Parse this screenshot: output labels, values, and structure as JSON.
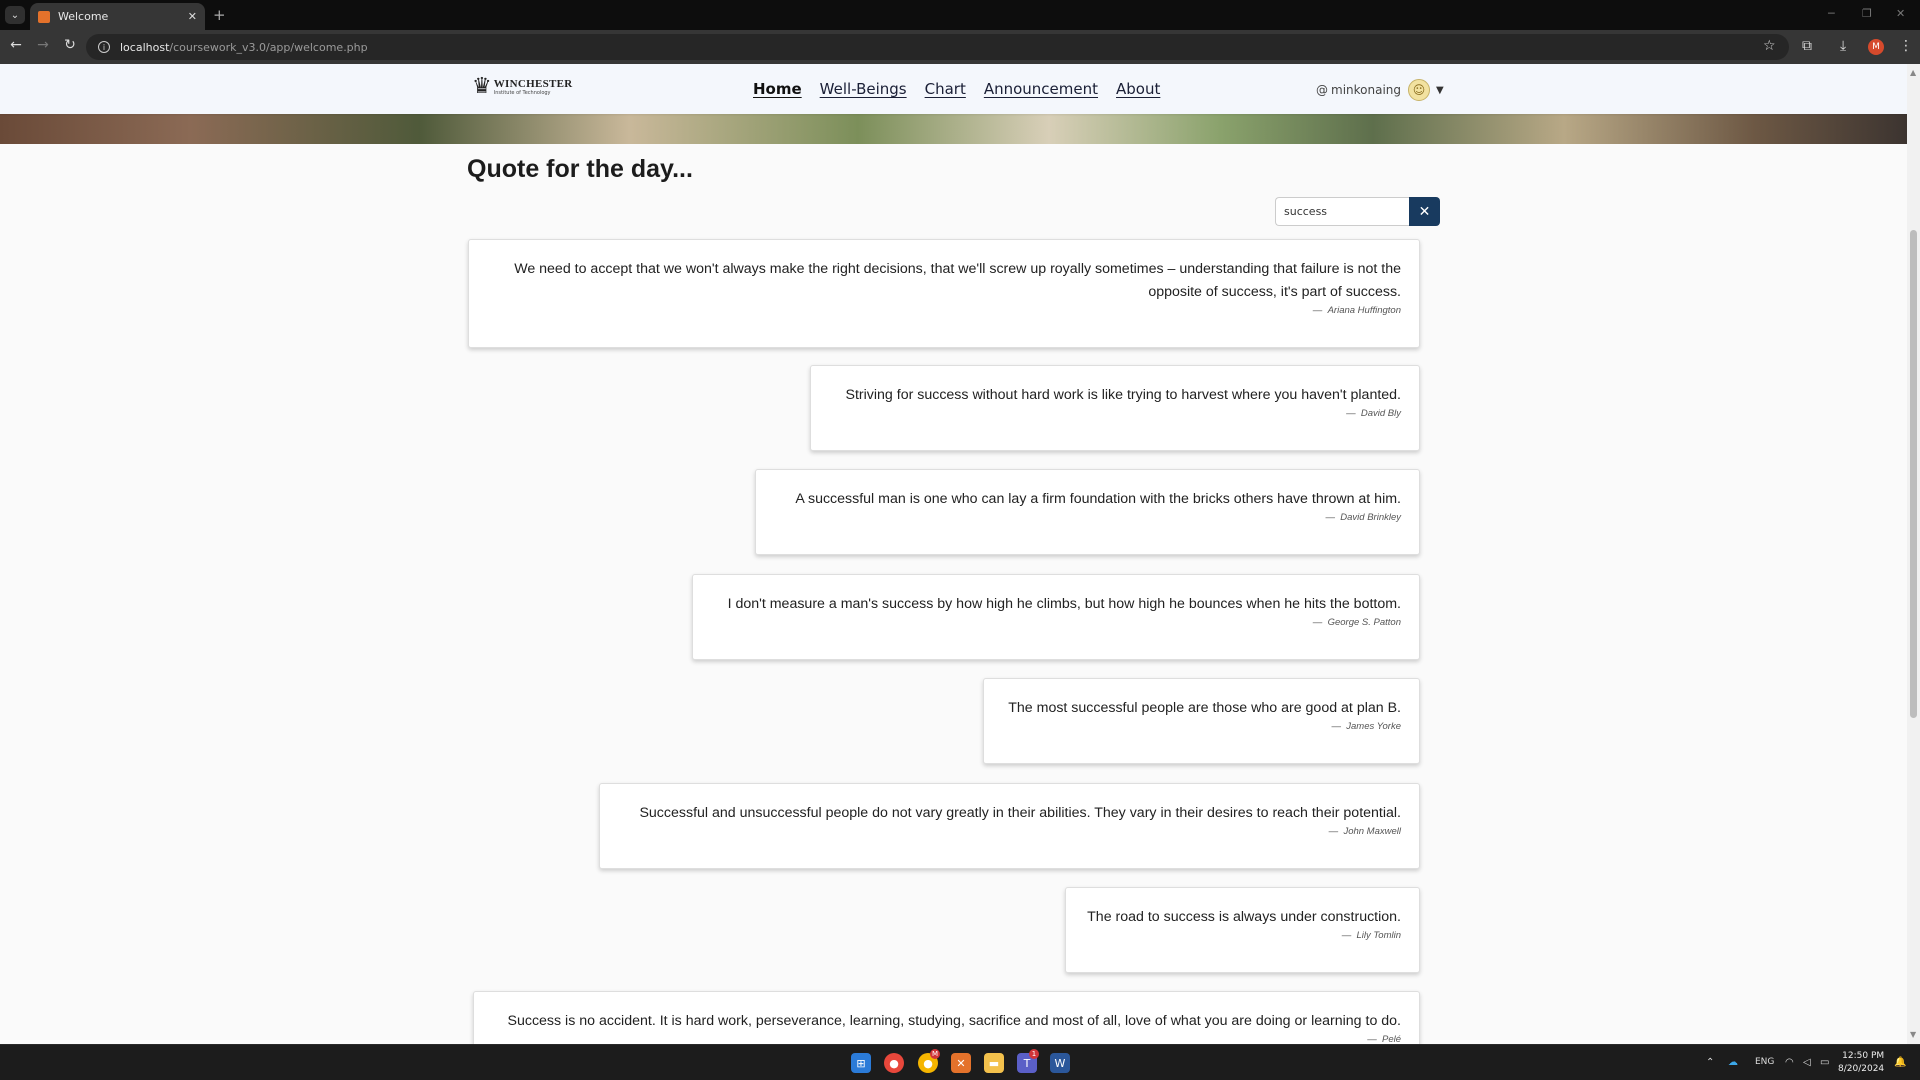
{
  "browser": {
    "tab_title": "Welcome",
    "tab_close": "✕",
    "new_tab": "+",
    "url_host": "localhost",
    "url_path": "/coursework_v3.0/app/welcome.php",
    "profile_initial": "M"
  },
  "site": {
    "logo_name": "WINCHESTER",
    "logo_sub": "Institute of Technology",
    "nav": [
      "Home",
      "Well-Beings",
      "Chart",
      "Announcement",
      "About"
    ],
    "active_nav": "Home",
    "username": "minkonaing",
    "user_prefix": "@"
  },
  "main": {
    "heading": "Quote for the day...",
    "search_value": "success",
    "clear_symbol": "✕",
    "quotes": [
      {
        "text": "We need to accept that we won't always make the right decisions, that we'll screw up royally sometimes – understanding that failure is not the opposite of success, it's part of success.",
        "author": "Ariana Huffington"
      },
      {
        "text": "Striving for success without hard work is like trying to harvest where you haven't planted.",
        "author": "David Bly"
      },
      {
        "text": "A successful man is one who can lay a firm foundation with the bricks others have thrown at him.",
        "author": "David Brinkley"
      },
      {
        "text": "I don't measure a man's success by how high he climbs, but how high he bounces when he hits the bottom.",
        "author": "George S. Patton"
      },
      {
        "text": "The most successful people are those who are good at plan B.",
        "author": "James Yorke"
      },
      {
        "text": "Successful and unsuccessful people do not vary greatly in their abilities. They vary in their desires to reach their potential.",
        "author": "John Maxwell"
      },
      {
        "text": "The road to success is always under construction.",
        "author": "Lily Tomlin"
      },
      {
        "text": "Success is no accident. It is hard work, perseverance, learning, studying, sacrifice and most of all, love of what you are doing or learning to do.",
        "author": "Pelé"
      }
    ]
  },
  "taskbar": {
    "language": "ENG",
    "time": "12:50 PM",
    "date": "8/20/2024",
    "chrome2_badge": "M",
    "teams_badge": "1"
  }
}
